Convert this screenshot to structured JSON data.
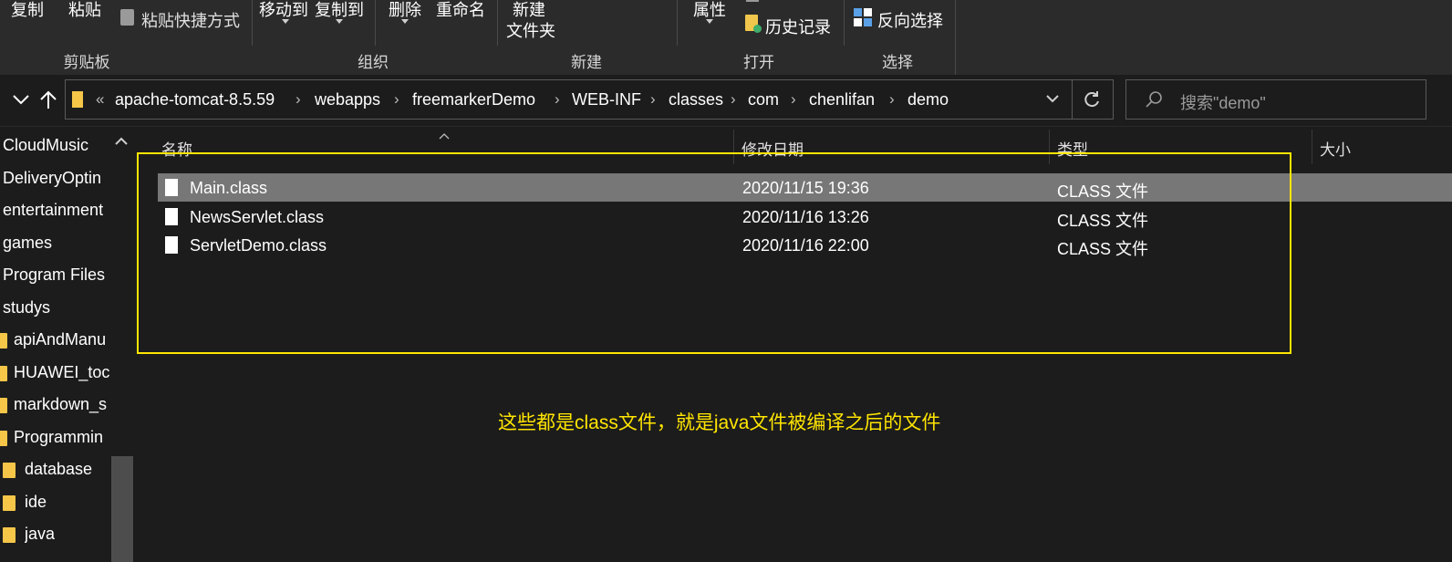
{
  "ribbon": {
    "copy": "复制",
    "paste": "粘贴",
    "paste_shortcut": "粘贴快捷方式",
    "move_to": "移动到",
    "copy_to": "复制到",
    "delete": "删除",
    "rename": "重命名",
    "new_folder_line1": "新建",
    "new_folder_line2": "文件夹",
    "properties": "属性",
    "history": "历史记录",
    "invert_selection": "反向选择",
    "groups": {
      "clipboard": "剪贴板",
      "organize": "组织",
      "new": "新建",
      "open": "打开",
      "select": "选择"
    }
  },
  "address": {
    "overflow": "«",
    "separator": "›",
    "crumbs": [
      "apache-tomcat-8.5.59",
      "webapps",
      "freemarkerDemo",
      "WEB-INF",
      "classes",
      "com",
      "chenlifan",
      "demo"
    ]
  },
  "search": {
    "placeholder": "搜索\"demo\""
  },
  "nav": {
    "items": [
      "CloudMusic",
      "DeliveryOptin",
      "entertainment",
      "games",
      "Program Files",
      "studys",
      "apiAndManu",
      "HUAWEI_toc",
      "markdown_s",
      "Programmin",
      "database",
      "ide",
      "java"
    ]
  },
  "columns": {
    "name": "名称",
    "modified": "修改日期",
    "type": "类型",
    "size": "大小"
  },
  "files": [
    {
      "name": "Main.class",
      "modified": "2020/11/15 19:36",
      "type": "CLASS 文件",
      "selected": true
    },
    {
      "name": "NewsServlet.class",
      "modified": "2020/11/16 13:26",
      "type": "CLASS 文件",
      "selected": false
    },
    {
      "name": "ServletDemo.class",
      "modified": "2020/11/16 22:00",
      "type": "CLASS 文件",
      "selected": false
    }
  ],
  "annotation": "这些都是class文件，就是java文件被编译之后的文件",
  "colors": {
    "background": "#1c1c1c",
    "ribbon": "#2b2b2b",
    "selection": "#777777",
    "annotation": "#ffe500",
    "folder": "#f5c648"
  }
}
